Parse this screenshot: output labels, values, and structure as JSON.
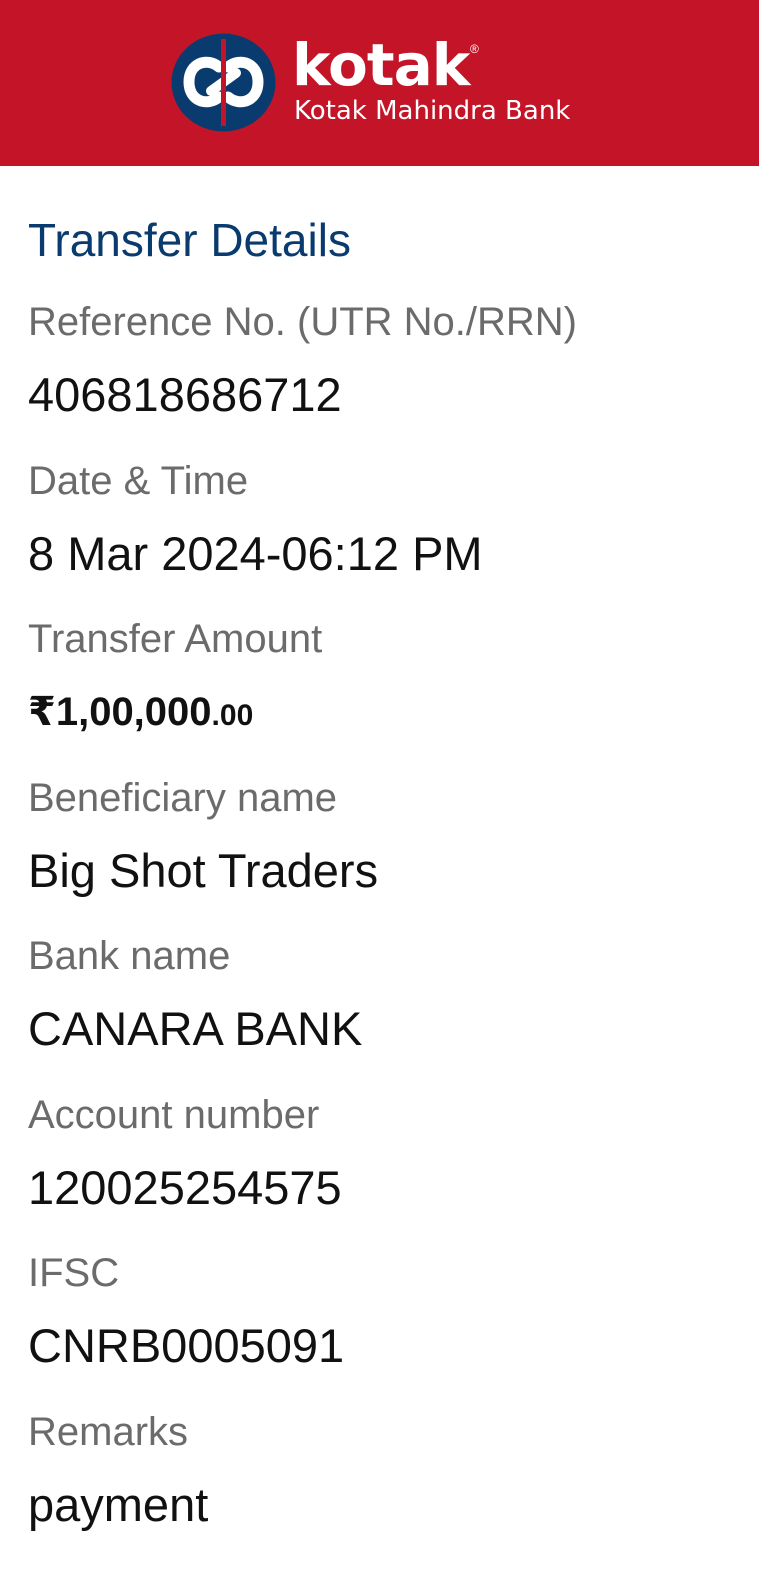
{
  "header": {
    "brand_name": "kotak",
    "registered_mark": "®",
    "brand_subtitle": "Kotak Mahindra Bank",
    "logo_icon": "kotak-infinity-logo-icon",
    "colors": {
      "background": "#c41528",
      "logo_circle": "#0a3b6e",
      "text": "#ffffff"
    }
  },
  "details": {
    "title": "Transfer Details",
    "reference": {
      "label": "Reference No. (UTR No./RRN)",
      "value": "406818686712"
    },
    "datetime": {
      "label": "Date & Time",
      "value": "8 Mar 2024-06:12 PM"
    },
    "amount": {
      "label": "Transfer Amount",
      "main": "₹1,00,000",
      "paise": ".00"
    },
    "beneficiary": {
      "label": "Beneficiary name",
      "value": "Big Shot Traders"
    },
    "bank": {
      "label": "Bank name",
      "value": "CANARA BANK"
    },
    "account": {
      "label": "Account number",
      "value": "120025254575"
    },
    "ifsc": {
      "label": "IFSC",
      "value": "CNRB0005091"
    },
    "remarks": {
      "label": "Remarks",
      "value": "payment"
    }
  }
}
